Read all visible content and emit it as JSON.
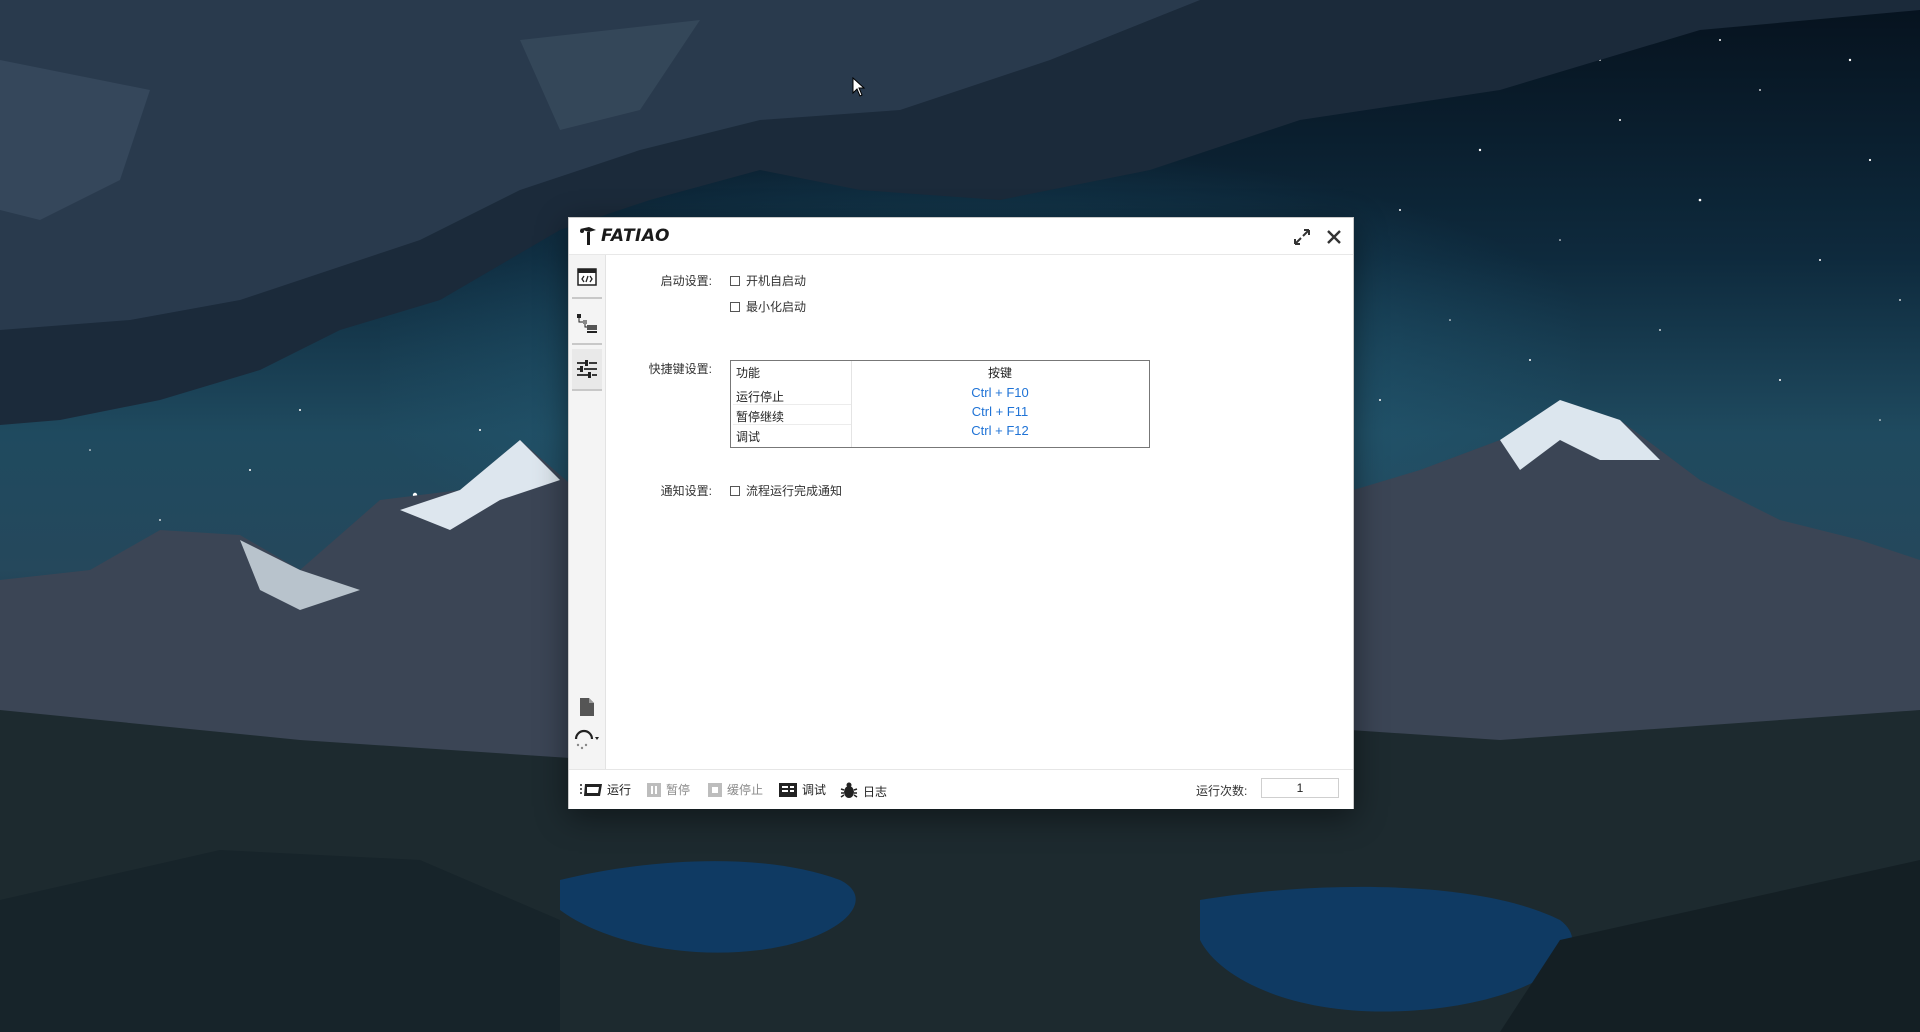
{
  "app": {
    "name": "FATIAO"
  },
  "sidebar": {
    "items": [
      {
        "id": "code",
        "icon": "code-icon"
      },
      {
        "id": "flow",
        "icon": "flow-icon"
      },
      {
        "id": "settings",
        "icon": "sliders-icon",
        "active": true
      }
    ],
    "bottom": [
      {
        "id": "file",
        "icon": "file-icon"
      },
      {
        "id": "theme",
        "icon": "theme-icon"
      }
    ]
  },
  "settings": {
    "startup": {
      "label": "启动设置:",
      "options": [
        {
          "label": "开机自启动",
          "checked": false
        },
        {
          "label": "最小化启动",
          "checked": false
        }
      ]
    },
    "hotkeys": {
      "label": "快捷键设置:",
      "columns": [
        "功能",
        "按键"
      ],
      "rows": [
        {
          "function": "运行停止",
          "key": "Ctrl + F10"
        },
        {
          "function": "暂停继续",
          "key": "Ctrl + F11"
        },
        {
          "function": "调试",
          "key": "Ctrl + F12"
        }
      ]
    },
    "notify": {
      "label": "通知设置:",
      "options": [
        {
          "label": "流程运行完成通知",
          "checked": false
        }
      ]
    }
  },
  "footer": {
    "buttons": [
      {
        "label": "运行",
        "icon": "run-icon",
        "enabled": true
      },
      {
        "label": "暂停",
        "icon": "pause-icon",
        "enabled": false
      },
      {
        "label": "缓停止",
        "icon": "stop-icon",
        "enabled": false
      },
      {
        "label": "调试",
        "icon": "debug-icon",
        "enabled": true
      },
      {
        "label": "日志",
        "icon": "bug-icon",
        "enabled": true
      }
    ],
    "run_count_label": "运行次数:",
    "run_count_value": "1"
  },
  "colors": {
    "hotkey_text": "#1f73d6",
    "disabled_text": "#8a8a8a"
  }
}
